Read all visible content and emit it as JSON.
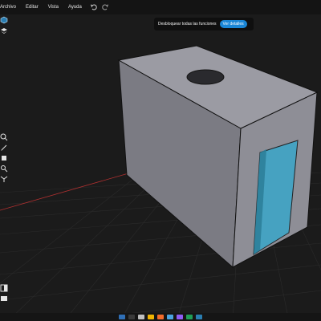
{
  "menu": {
    "items": [
      "Archivo",
      "Editar",
      "Vista",
      "Ayuda"
    ]
  },
  "promo": {
    "text": "Desbloquear todas las funciones",
    "button": "Ver detalles"
  },
  "icons": {
    "undo": "undo-icon",
    "redo": "redo-icon",
    "cube": "cube-icon",
    "layers": "layers-icon",
    "search": "search-icon",
    "pen": "pen-icon",
    "paint": "paint-icon",
    "magnifier": "magnifier-icon",
    "axis": "axis-gizmo-icon",
    "panel": "panel-toggle-icon"
  },
  "colors": {
    "accent": "#1a86d6",
    "box_top": "#9a9aa3",
    "box_left": "#7b7b83",
    "box_right": "#8f8f97",
    "door": "#3aa6c9"
  },
  "taskbar": {
    "apps": [
      "app-1",
      "app-2",
      "app-3",
      "app-4",
      "app-5",
      "app-6",
      "app-7",
      "app-8",
      "app-9"
    ]
  }
}
